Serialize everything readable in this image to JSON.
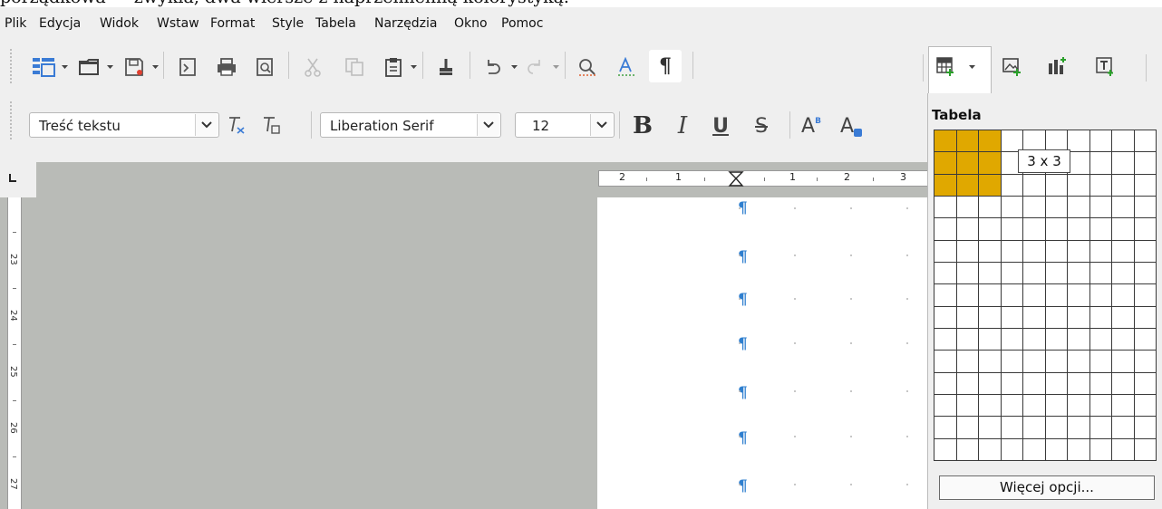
{
  "top_cut_text": "porządkowa — zwykła, dwa wiersze z naprzemienną kolorystyką.",
  "menu": [
    {
      "label": "Plik"
    },
    {
      "label": "Edycja"
    },
    {
      "label": "Widok"
    },
    {
      "label": "Wstaw"
    },
    {
      "label": "Format"
    },
    {
      "label": "Style"
    },
    {
      "label": "Tabela"
    },
    {
      "label": "Narzędzia"
    },
    {
      "label": "Okno"
    },
    {
      "label": "Pomoc"
    }
  ],
  "formatting": {
    "paragraph_style": "Treść tekstu",
    "font_name": "Liberation Serif",
    "font_size": "12",
    "bold_label": "B",
    "italic_label": "I",
    "underline_label": "U",
    "strike_label": "S",
    "superscript_label": "A",
    "subscript_label": "A"
  },
  "ruler": {
    "h_labels": [
      "2",
      "1",
      "1",
      "2",
      "3"
    ],
    "v_labels": [
      "23",
      "24",
      "25",
      "26",
      "27"
    ]
  },
  "document": {
    "paragraph_mark": "¶"
  },
  "table_popup": {
    "title": "Tabela",
    "columns": 10,
    "rows": 15,
    "selected_cols": 3,
    "selected_rows": 3,
    "size_label": "3 x 3",
    "more_options_label": "Więcej opcji..."
  },
  "colors": {
    "selection": "#e0a800",
    "pilcrow": "#2f7fcf",
    "toolbar_bg": "#efefef",
    "workspace_bg": "#b9bbb7"
  }
}
